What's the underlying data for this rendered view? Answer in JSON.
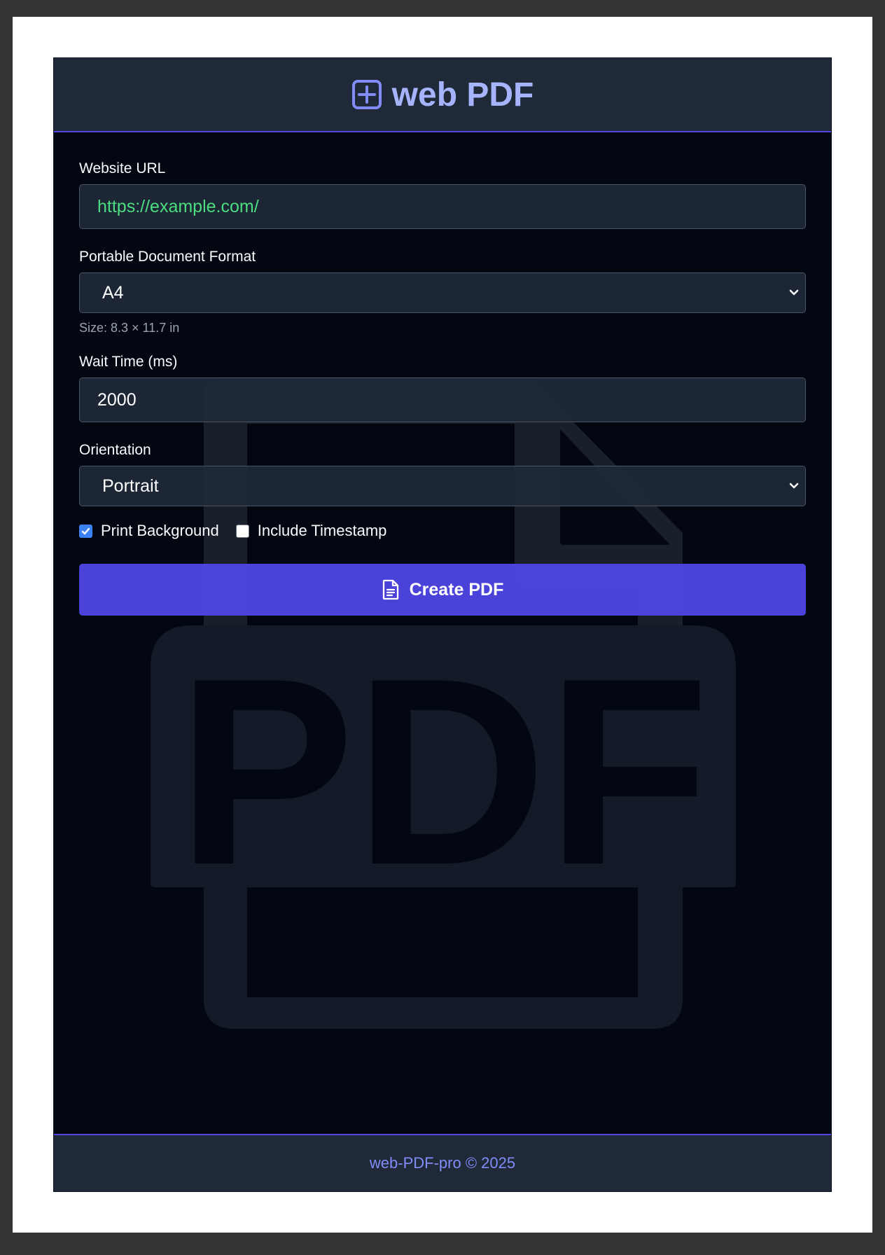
{
  "header": {
    "title": "web PDF",
    "icon": "plus-square-icon"
  },
  "form": {
    "url": {
      "label": "Website URL",
      "value": "https://example.com/"
    },
    "format": {
      "label": "Portable Document Format",
      "selected": "A4",
      "hint": "Size: 8.3 × 11.7 in"
    },
    "wait": {
      "label": "Wait Time (ms)",
      "value": "2000"
    },
    "orientation": {
      "label": "Orientation",
      "selected": "Portrait"
    },
    "print_background": {
      "label": "Print Background",
      "checked": true
    },
    "include_timestamp": {
      "label": "Include Timestamp",
      "checked": false
    },
    "submit_label": "Create PDF",
    "submit_icon": "document-icon"
  },
  "watermark": {
    "text": "PDF",
    "icon": "pdf-file-icon"
  },
  "footer": {
    "text": "web-PDF-pro © 2025"
  },
  "colors": {
    "accent": "#4f46e5",
    "title": "#a5b4fc",
    "url_text": "#4ade80",
    "background": "#030712",
    "panel": "#1f2937"
  }
}
